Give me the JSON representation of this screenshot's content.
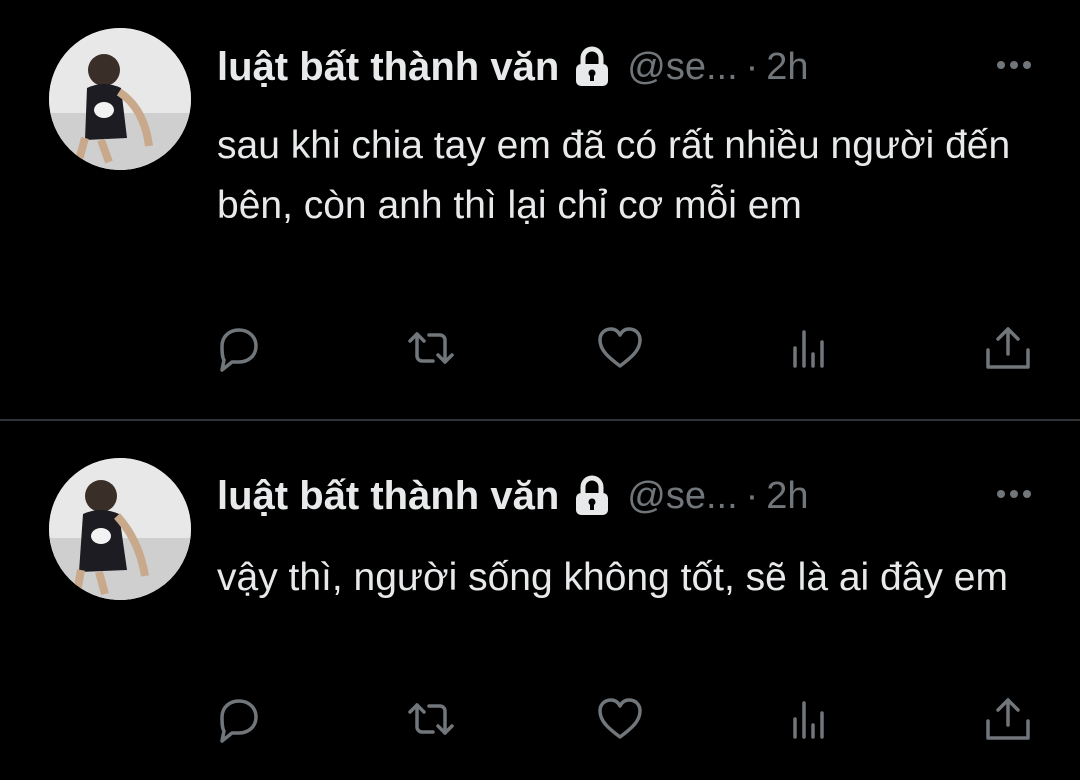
{
  "tweets": [
    {
      "name": "luật bất thành văn",
      "handle": "@se...",
      "separator": "·",
      "time": "2h",
      "text": "sau khi chia tay em đã có rất nhiều người đến bên, còn anh thì lại chỉ cơ mỗi em"
    },
    {
      "name": "luật bất thành văn",
      "handle": "@se...",
      "separator": "·",
      "time": "2h",
      "text": "vậy thì, người sống không tốt, sẽ là ai đây em"
    }
  ],
  "icons": {
    "lock": "lock-icon",
    "more": "more-dots-icon",
    "reply": "reply-icon",
    "retweet": "retweet-icon",
    "like": "heart-icon",
    "views": "analytics-icon",
    "share": "share-icon"
  },
  "colors": {
    "background": "#000000",
    "text": "#e7e9ea",
    "secondary": "#71767b",
    "divider": "#2f3336"
  }
}
